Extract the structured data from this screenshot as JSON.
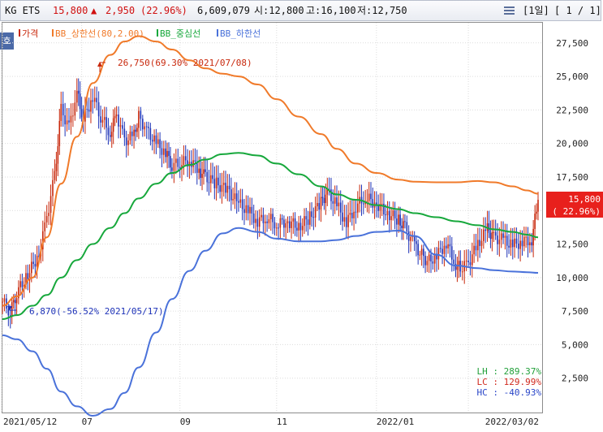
{
  "header": {
    "name": "KG ETS",
    "price": "15,800",
    "change_arrow": "▲",
    "change": "2,950",
    "change_pct": "(22.96%)",
    "volume": "6,609,079",
    "open_label": "시:12,800",
    "high_label": "고:16,100",
    "low_label": "저:12,750",
    "period_menu": "[1일]",
    "page": "[ 1 / 1]",
    "menu_icon": "hamburger-icon"
  },
  "side_tab": {
    "label": "호"
  },
  "colors": {
    "price_up": "#c8280c",
    "price_down": "#1e33b8",
    "upper_band": "#f07a2a",
    "middle_band": "#17a83c",
    "lower_band": "#4a72da",
    "current_price_box": "#e8201c"
  },
  "chart_data": {
    "type": "line",
    "title": "",
    "legend": [
      {
        "label": "가격",
        "color": "#c8280c"
      },
      {
        "label": "BB_상한선(80,2.00)",
        "color": "#f07a2a"
      },
      {
        "label": "BB_중심선",
        "color": "#17a83c"
      },
      {
        "label": "BB_하한선",
        "color": "#4a72da"
      }
    ],
    "legend_position": "top-left",
    "x_ticks": [
      "2021/05/12",
      "07",
      "09",
      "11",
      "2022/01",
      "2022/03/02"
    ],
    "y_ticks": [
      "2,500",
      "5,000",
      "7,500",
      "10,000",
      "12,500",
      "15,000",
      "17,500",
      "20,000",
      "22,500",
      "25,000",
      "27,500"
    ],
    "ylim": [
      0,
      29000
    ],
    "grid": true,
    "series": [
      {
        "name": "가격",
        "kind": "candlestick-close",
        "points": [
          [
            "2021/05/12",
            8200
          ],
          [
            "2021/05/17",
            7400
          ],
          [
            "2021/05/21",
            8900
          ],
          [
            "2021/05/28",
            10200
          ],
          [
            "2021/06/04",
            11800
          ],
          [
            "2021/06/09",
            14500
          ],
          [
            "2021/06/14",
            17600
          ],
          [
            "2021/06/18",
            22500
          ],
          [
            "2021/06/23",
            21200
          ],
          [
            "2021/06/28",
            23800
          ],
          [
            "2021/07/02",
            21800
          ],
          [
            "2021/07/08",
            23500
          ],
          [
            "2021/07/13",
            22000
          ],
          [
            "2021/07/19",
            20800
          ],
          [
            "2021/07/23",
            22200
          ],
          [
            "2021/07/28",
            20200
          ],
          [
            "2021/08/03",
            20600
          ],
          [
            "2021/08/06",
            22000
          ],
          [
            "2021/08/11",
            21000
          ],
          [
            "2021/08/17",
            20000
          ],
          [
            "2021/08/23",
            19300
          ],
          [
            "2021/08/27",
            18400
          ],
          [
            "2021/09/01",
            18500
          ],
          [
            "2021/09/07",
            18800
          ],
          [
            "2021/09/13",
            18000
          ],
          [
            "2021/09/17",
            17500
          ],
          [
            "2021/09/24",
            17000
          ],
          [
            "2021/10/01",
            16500
          ],
          [
            "2021/10/08",
            15500
          ],
          [
            "2021/10/14",
            15000
          ],
          [
            "2021/10/20",
            14200
          ],
          [
            "2021/10/26",
            14500
          ],
          [
            "2021/11/01",
            14000
          ],
          [
            "2021/11/08",
            14200
          ],
          [
            "2021/11/15",
            13800
          ],
          [
            "2021/11/22",
            14500
          ],
          [
            "2021/11/29",
            15600
          ],
          [
            "2021/12/03",
            16400
          ],
          [
            "2021/12/09",
            15400
          ],
          [
            "2021/12/15",
            14100
          ],
          [
            "2021/12/21",
            15300
          ],
          [
            "2021/12/27",
            16000
          ],
          [
            "2022/01/03",
            15500
          ],
          [
            "2022/01/10",
            14800
          ],
          [
            "2022/01/17",
            14300
          ],
          [
            "2022/01/21",
            13700
          ],
          [
            "2022/01/27",
            12400
          ],
          [
            "2022/02/04",
            11200
          ],
          [
            "2022/02/10",
            11600
          ],
          [
            "2022/02/16",
            12600
          ],
          [
            "2022/02/22",
            11000
          ],
          [
            "2022/02/25",
            10700
          ],
          [
            "2022/03/02",
            11100
          ],
          [
            "2022/03/08",
            12500
          ],
          [
            "2022/03/14",
            13600
          ],
          [
            "2022/03/18",
            13000
          ],
          [
            "2022/03/24",
            12800
          ],
          [
            "2022/03/30",
            12400
          ],
          [
            "2022/04/05",
            12700
          ],
          [
            "2022/04/11",
            12850
          ],
          [
            "2022/04/15",
            15800
          ]
        ]
      },
      {
        "name": "BB_상한선(80,2.00)",
        "points": [
          [
            "2021/05/12",
            7900
          ],
          [
            "2021/05/21",
            8600
          ],
          [
            "2021/05/31",
            10000
          ],
          [
            "2021/06/09",
            13000
          ],
          [
            "2021/06/18",
            17000
          ],
          [
            "2021/06/28",
            20500
          ],
          [
            "2021/07/08",
            24500
          ],
          [
            "2021/07/19",
            26600
          ],
          [
            "2021/07/28",
            27600
          ],
          [
            "2021/08/06",
            28000
          ],
          [
            "2021/08/17",
            27600
          ],
          [
            "2021/08/27",
            27000
          ],
          [
            "2021/09/07",
            26200
          ],
          [
            "2021/09/17",
            25600
          ],
          [
            "2021/09/28",
            25200
          ],
          [
            "2021/10/08",
            25000
          ],
          [
            "2021/10/20",
            24400
          ],
          [
            "2021/11/01",
            23300
          ],
          [
            "2021/11/15",
            22000
          ],
          [
            "2021/11/29",
            20700
          ],
          [
            "2021/12/09",
            19600
          ],
          [
            "2021/12/21",
            18500
          ],
          [
            "2022/01/03",
            17800
          ],
          [
            "2022/01/17",
            17300
          ],
          [
            "2022/01/27",
            17150
          ],
          [
            "2022/02/10",
            17100
          ],
          [
            "2022/02/22",
            17100
          ],
          [
            "2022/03/08",
            17200
          ],
          [
            "2022/03/18",
            17100
          ],
          [
            "2022/03/30",
            16800
          ],
          [
            "2022/04/08",
            16500
          ],
          [
            "2022/04/15",
            16250
          ]
        ]
      },
      {
        "name": "BB_중심선",
        "points": [
          [
            "2021/05/12",
            6900
          ],
          [
            "2021/05/21",
            7200
          ],
          [
            "2021/05/31",
            7900
          ],
          [
            "2021/06/09",
            8700
          ],
          [
            "2021/06/18",
            10000
          ],
          [
            "2021/06/28",
            11300
          ],
          [
            "2021/07/08",
            12500
          ],
          [
            "2021/07/19",
            13700
          ],
          [
            "2021/07/28",
            14800
          ],
          [
            "2021/08/06",
            15900
          ],
          [
            "2021/08/17",
            17000
          ],
          [
            "2021/08/27",
            17800
          ],
          [
            "2021/09/07",
            18400
          ],
          [
            "2021/09/17",
            18800
          ],
          [
            "2021/09/28",
            19200
          ],
          [
            "2021/10/08",
            19300
          ],
          [
            "2021/10/20",
            19100
          ],
          [
            "2021/11/01",
            18500
          ],
          [
            "2021/11/15",
            17700
          ],
          [
            "2021/11/29",
            16800
          ],
          [
            "2021/12/09",
            16200
          ],
          [
            "2021/12/21",
            15800
          ],
          [
            "2022/01/03",
            15400
          ],
          [
            "2022/01/17",
            15100
          ],
          [
            "2022/01/27",
            14800
          ],
          [
            "2022/02/10",
            14500
          ],
          [
            "2022/02/22",
            14200
          ],
          [
            "2022/03/08",
            13900
          ],
          [
            "2022/03/18",
            13600
          ],
          [
            "2022/03/30",
            13400
          ],
          [
            "2022/04/08",
            13200
          ],
          [
            "2022/04/15",
            13000
          ]
        ]
      },
      {
        "name": "BB_하한선",
        "points": [
          [
            "2021/05/12",
            5700
          ],
          [
            "2021/05/21",
            5400
          ],
          [
            "2021/05/31",
            4500
          ],
          [
            "2021/06/09",
            3200
          ],
          [
            "2021/06/18",
            1500
          ],
          [
            "2021/06/28",
            400
          ],
          [
            "2021/07/08",
            -300
          ],
          [
            "2021/07/19",
            200
          ],
          [
            "2021/07/28",
            1400
          ],
          [
            "2021/08/06",
            3300
          ],
          [
            "2021/08/17",
            5900
          ],
          [
            "2021/08/27",
            8400
          ],
          [
            "2021/09/07",
            10500
          ],
          [
            "2021/09/17",
            12000
          ],
          [
            "2021/09/28",
            13300
          ],
          [
            "2021/10/08",
            13700
          ],
          [
            "2021/10/20",
            13400
          ],
          [
            "2021/11/01",
            12900
          ],
          [
            "2021/11/15",
            12700
          ],
          [
            "2021/11/29",
            12700
          ],
          [
            "2021/12/09",
            12800
          ],
          [
            "2021/12/21",
            13100
          ],
          [
            "2022/01/03",
            13400
          ],
          [
            "2022/01/17",
            13500
          ],
          [
            "2022/01/27",
            13100
          ],
          [
            "2022/02/10",
            11700
          ],
          [
            "2022/02/22",
            10900
          ],
          [
            "2022/03/08",
            10700
          ],
          [
            "2022/03/18",
            10550
          ],
          [
            "2022/03/30",
            10450
          ],
          [
            "2022/04/08",
            10400
          ],
          [
            "2022/04/15",
            10350
          ]
        ]
      }
    ],
    "annotations": [
      {
        "text": "26,750(69.30% 2021/07/08)",
        "x": "2021/07/08",
        "y": 26750,
        "color": "#c8280c"
      },
      {
        "text": "6,870(-56.52% 2021/05/17)",
        "x": "2021/05/17",
        "y": 6870,
        "color": "#1e33b8"
      }
    ],
    "current_price": {
      "value": "15,800",
      "change": "( 22.96%)",
      "y": 15800
    },
    "stats": [
      {
        "label": "LH : ",
        "value": "289.37%",
        "color": "#22a03a"
      },
      {
        "label": "LC : ",
        "value": "129.99%",
        "color": "#d0281c"
      },
      {
        "label": "HC : ",
        "value": "-40.93%",
        "color": "#2a46c8"
      }
    ]
  }
}
